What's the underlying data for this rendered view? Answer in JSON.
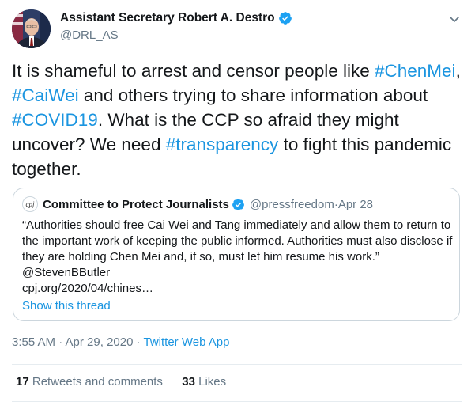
{
  "author": {
    "display_name": "Assistant Secretary Robert A. Destro",
    "handle": "@DRL_AS"
  },
  "tweet": {
    "segments": [
      {
        "text": "It is shameful to arrest and censor people like ",
        "type": "text"
      },
      {
        "text": "#ChenMei",
        "type": "hashtag"
      },
      {
        "text": ", ",
        "type": "text"
      },
      {
        "text": "#CaiWei",
        "type": "hashtag"
      },
      {
        "text": " and others trying to share information about ",
        "type": "text"
      },
      {
        "text": "#COVID19",
        "type": "hashtag"
      },
      {
        "text": ".  What is the CCP so afraid they might uncover?  We need ",
        "type": "text"
      },
      {
        "text": "#transparency",
        "type": "hashtag"
      },
      {
        "text": " to fight this pandemic together.",
        "type": "text"
      }
    ]
  },
  "quote": {
    "avatar_text": "cpj",
    "name": "Committee to Protect Journalists",
    "handle": "@pressfreedom",
    "separator": " · ",
    "date": "Apr 28",
    "text": "“Authorities should free Cai Wei and Tang immediately and allow them to return to the important work of keeping the public informed. Authorities must also disclose if they are holding Chen Mei and, if so, must let him resume his work.” @StevenBButler",
    "link": "cpj.org/2020/04/chines…",
    "show_thread": "Show this thread"
  },
  "timestamp": {
    "time_date": "3:55 AM · Apr 29, 2020",
    "separator": " · ",
    "app": "Twitter Web App"
  },
  "stats": {
    "retweets_count": "17",
    "retweets_label": " Retweets and comments",
    "likes_count": "33",
    "likes_label": " Likes"
  },
  "colors": {
    "link": "#1b95e0",
    "text": "#14171a",
    "secondary": "#657786",
    "border": "#ccd6dd"
  }
}
